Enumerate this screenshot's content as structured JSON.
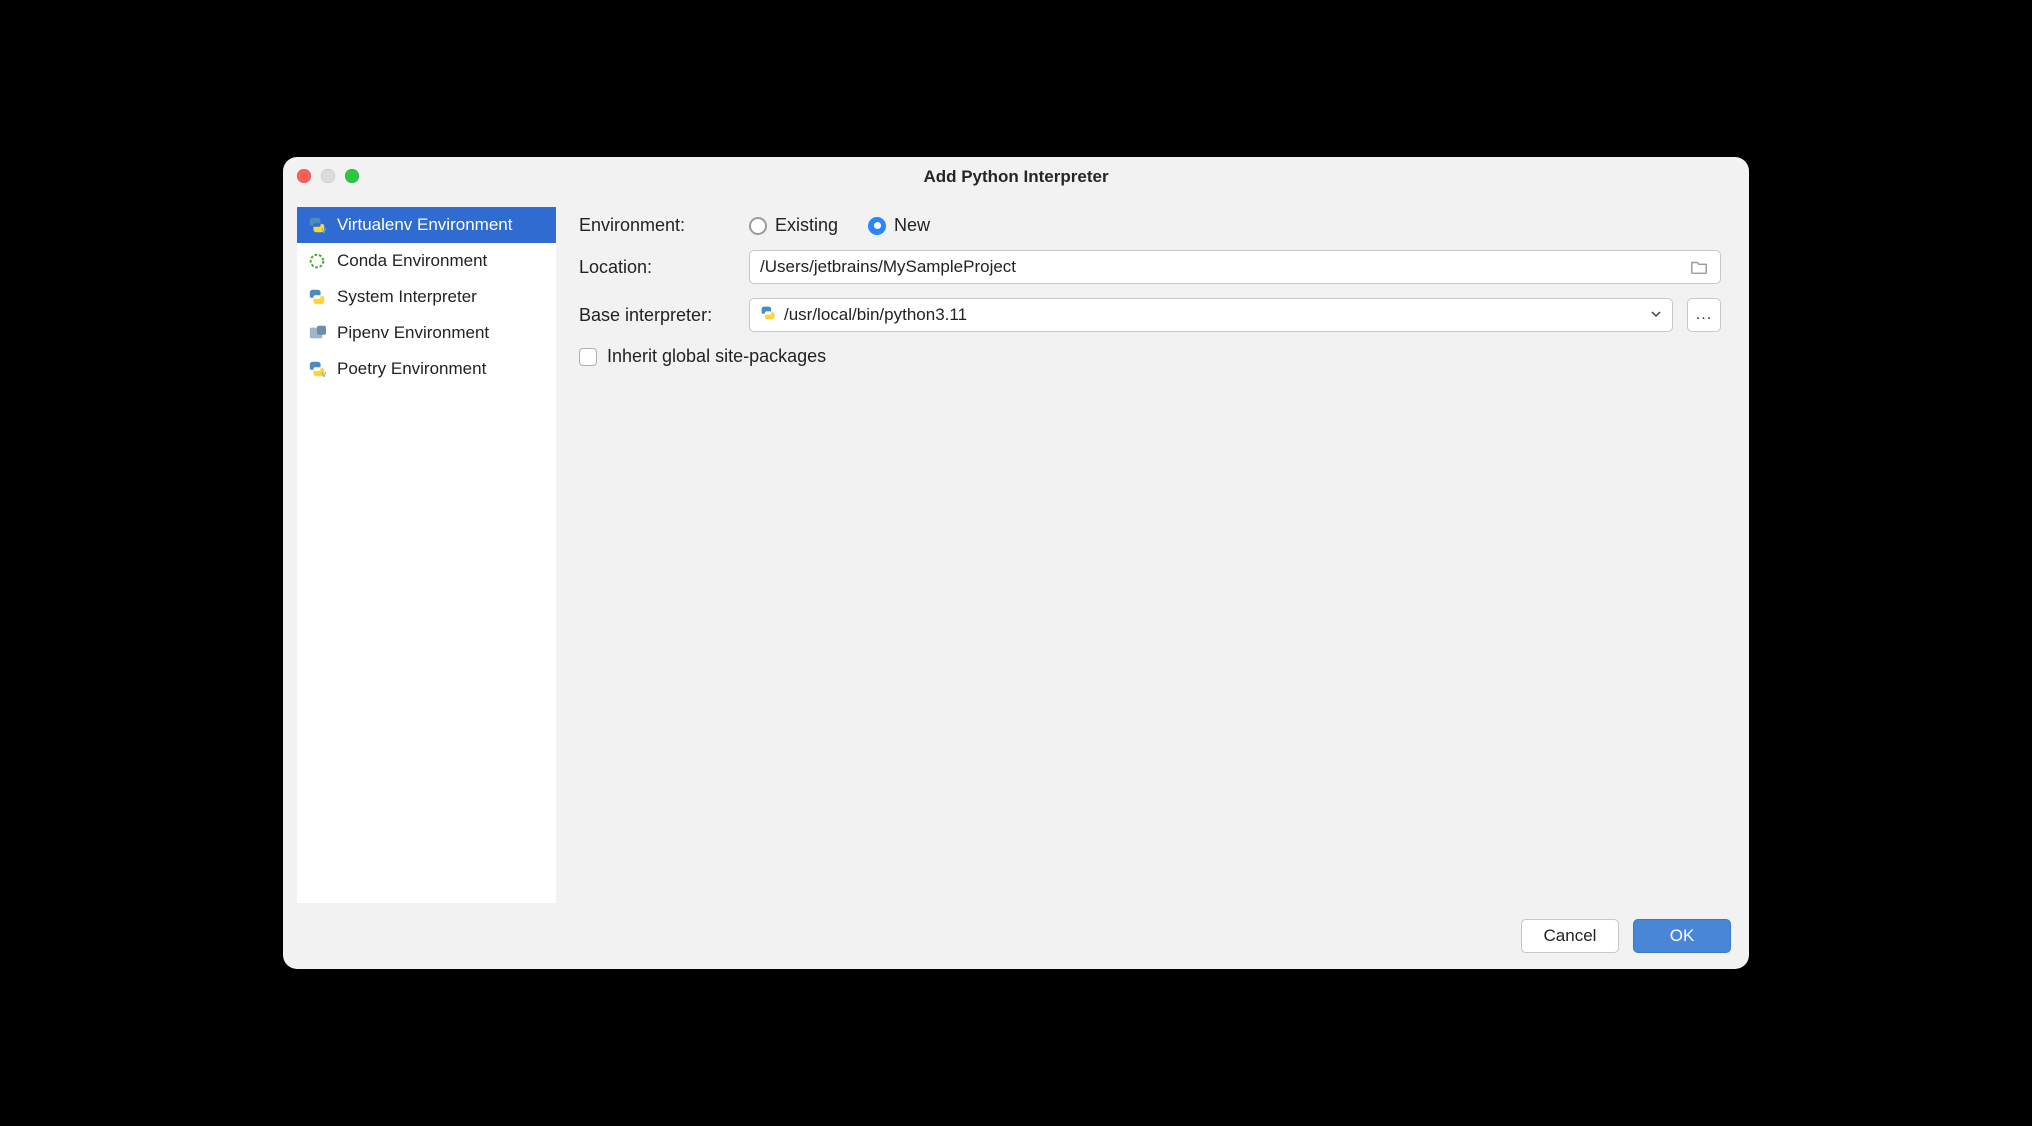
{
  "window": {
    "title": "Add Python Interpreter"
  },
  "sidebar": {
    "items": [
      {
        "label": "Virtualenv Environment",
        "icon": "python-v"
      },
      {
        "label": "Conda Environment",
        "icon": "conda"
      },
      {
        "label": "System Interpreter",
        "icon": "python"
      },
      {
        "label": "Pipenv Environment",
        "icon": "pipenv"
      },
      {
        "label": "Poetry Environment",
        "icon": "python-v"
      }
    ],
    "selected_index": 0
  },
  "form": {
    "environment_label": "Environment:",
    "radio_existing": "Existing",
    "radio_new": "New",
    "radio_selected": "new",
    "location_label": "Location:",
    "location_value": "/Users/jetbrains/MySampleProject",
    "base_interpreter_label": "Base interpreter:",
    "base_interpreter_value": "/usr/local/bin/python3.11",
    "browse_button": "...",
    "inherit_checkbox_label": "Inherit global site-packages",
    "inherit_checked": false
  },
  "footer": {
    "cancel": "Cancel",
    "ok": "OK"
  }
}
